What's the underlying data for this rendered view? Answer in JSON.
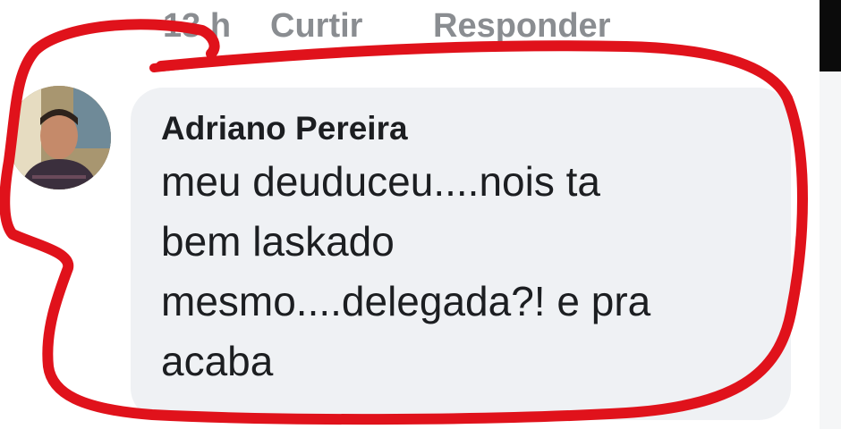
{
  "comment_actions": {
    "time": "13 h",
    "like_label": "Curtir",
    "reply_label": "Responder"
  },
  "comment": {
    "author": "Adriano Pereira",
    "text": "meu deuduceu....nois ta\nbem laskado\nmesmo....delegada?! e pra\nacaba"
  },
  "colors": {
    "annotation": "#e0121b",
    "bubble": "#eff1f4",
    "meta_text": "#8a8d91"
  }
}
